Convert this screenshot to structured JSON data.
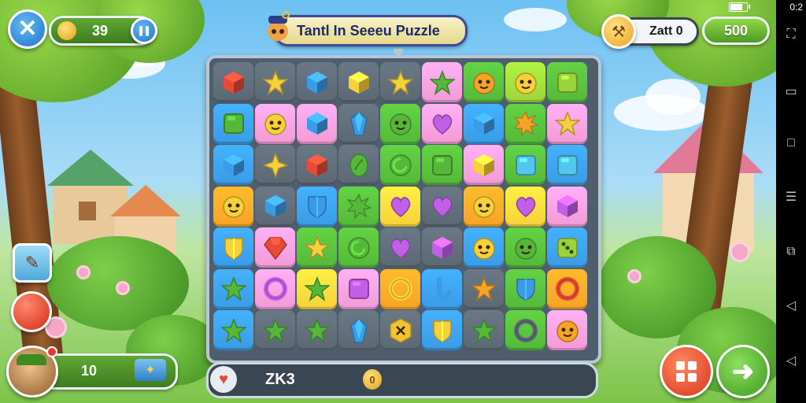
{
  "header": {
    "coins": "39",
    "title": "Tantl In Seeeu Puzzle",
    "score_label": "Zatt 0",
    "gems": "500"
  },
  "bottom": {
    "level": "10",
    "score_text": "ZK3",
    "coin_badge": "0"
  },
  "status": {
    "clock": "0:2"
  },
  "colors": {
    "red": "#e84a35",
    "orange": "#f7a325",
    "yellow": "#f6d13a",
    "green": "#55b83a",
    "lime": "#9bd43a",
    "blue": "#3a9be6",
    "cyan": "#53c6ee",
    "pink": "#f29ad5",
    "purple": "#c160e6",
    "gray": "#5c6874",
    "gold": "#f2c330"
  },
  "board": [
    [
      {
        "bg": "gray",
        "p": "cube",
        "c": "red"
      },
      {
        "bg": "gray",
        "p": "star",
        "c": "yellow"
      },
      {
        "bg": "gray",
        "p": "cube",
        "c": "blue"
      },
      {
        "bg": "gray",
        "p": "cube",
        "c": "yellow"
      },
      {
        "bg": "gray",
        "p": "star",
        "c": "yellow"
      },
      {
        "bg": "pink",
        "p": "star",
        "c": "green"
      },
      {
        "bg": "green",
        "p": "face",
        "c": "orange"
      },
      {
        "bg": "lime",
        "p": "face",
        "c": "yellow"
      },
      {
        "bg": "green",
        "p": "square",
        "c": "lime"
      }
    ],
    [
      {
        "bg": "blue",
        "p": "square",
        "c": "green"
      },
      {
        "bg": "pink",
        "p": "face",
        "c": "yellow"
      },
      {
        "bg": "pink",
        "p": "cube",
        "c": "blue"
      },
      {
        "bg": "gray",
        "p": "crystal",
        "c": "blue"
      },
      {
        "bg": "green",
        "p": "face",
        "c": "green"
      },
      {
        "bg": "pink",
        "p": "heart",
        "c": "purple"
      },
      {
        "bg": "blue",
        "p": "cube",
        "c": "blue"
      },
      {
        "bg": "green",
        "p": "burst",
        "c": "orange"
      },
      {
        "bg": "pink",
        "p": "star",
        "c": "yellow"
      }
    ],
    [
      {
        "bg": "blue",
        "p": "cube",
        "c": "blue"
      },
      {
        "bg": "gray",
        "p": "star4",
        "c": "yellow"
      },
      {
        "bg": "gray",
        "p": "cube",
        "c": "red"
      },
      {
        "bg": "gray",
        "p": "leaf",
        "c": "green"
      },
      {
        "bg": "green",
        "p": "swirl",
        "c": "green"
      },
      {
        "bg": "green",
        "p": "square",
        "c": "green"
      },
      {
        "bg": "pink",
        "p": "cube",
        "c": "yellow"
      },
      {
        "bg": "green",
        "p": "square",
        "c": "cyan"
      },
      {
        "bg": "blue",
        "p": "square",
        "c": "cyan"
      }
    ],
    [
      {
        "bg": "orange",
        "p": "face",
        "c": "yellow"
      },
      {
        "bg": "gray",
        "p": "cube",
        "c": "blue"
      },
      {
        "bg": "blue",
        "p": "shield",
        "c": "blue"
      },
      {
        "bg": "green",
        "p": "burst",
        "c": "green"
      },
      {
        "bg": "yellow",
        "p": "heart",
        "c": "purple"
      },
      {
        "bg": "gray",
        "p": "heart",
        "c": "purple"
      },
      {
        "bg": "orange",
        "p": "face",
        "c": "yellow"
      },
      {
        "bg": "yellow",
        "p": "heart",
        "c": "purple"
      },
      {
        "bg": "pink",
        "p": "cube",
        "c": "purple"
      }
    ],
    [
      {
        "bg": "blue",
        "p": "shield",
        "c": "yellow"
      },
      {
        "bg": "pink",
        "p": "gem",
        "c": "red"
      },
      {
        "bg": "green",
        "p": "star",
        "c": "yellow"
      },
      {
        "bg": "green",
        "p": "swirl",
        "c": "green"
      },
      {
        "bg": "gray",
        "p": "heart",
        "c": "purple"
      },
      {
        "bg": "gray",
        "p": "cube",
        "c": "purple"
      },
      {
        "bg": "blue",
        "p": "face",
        "c": "yellow"
      },
      {
        "bg": "green",
        "p": "face",
        "c": "green"
      },
      {
        "bg": "blue",
        "p": "dice",
        "c": "lime"
      }
    ],
    [
      {
        "bg": "blue",
        "p": "star",
        "c": "green"
      },
      {
        "bg": "pink",
        "p": "ring",
        "c": "purple"
      },
      {
        "bg": "yellow",
        "p": "star",
        "c": "green"
      },
      {
        "bg": "pink",
        "p": "square",
        "c": "purple"
      },
      {
        "bg": "orange",
        "p": "ring",
        "c": "yellow"
      },
      {
        "bg": "blue",
        "p": "hook",
        "c": "blue"
      },
      {
        "bg": "gray",
        "p": "star",
        "c": "orange"
      },
      {
        "bg": "green",
        "p": "shield",
        "c": "blue"
      },
      {
        "bg": "orange",
        "p": "ring",
        "c": "red"
      }
    ],
    [
      {
        "bg": "blue",
        "p": "star",
        "c": "green"
      },
      {
        "bg": "gray",
        "p": "star",
        "c": "green"
      },
      {
        "bg": "gray",
        "p": "star",
        "c": "green"
      },
      {
        "bg": "gray",
        "p": "crystal",
        "c": "blue"
      },
      {
        "bg": "gray",
        "p": "hex",
        "c": "gold"
      },
      {
        "bg": "blue",
        "p": "shield",
        "c": "yellow"
      },
      {
        "bg": "gray",
        "p": "star",
        "c": "green"
      },
      {
        "bg": "green",
        "p": "ring",
        "c": "gray"
      },
      {
        "bg": "pink",
        "p": "face",
        "c": "orange"
      }
    ]
  ]
}
